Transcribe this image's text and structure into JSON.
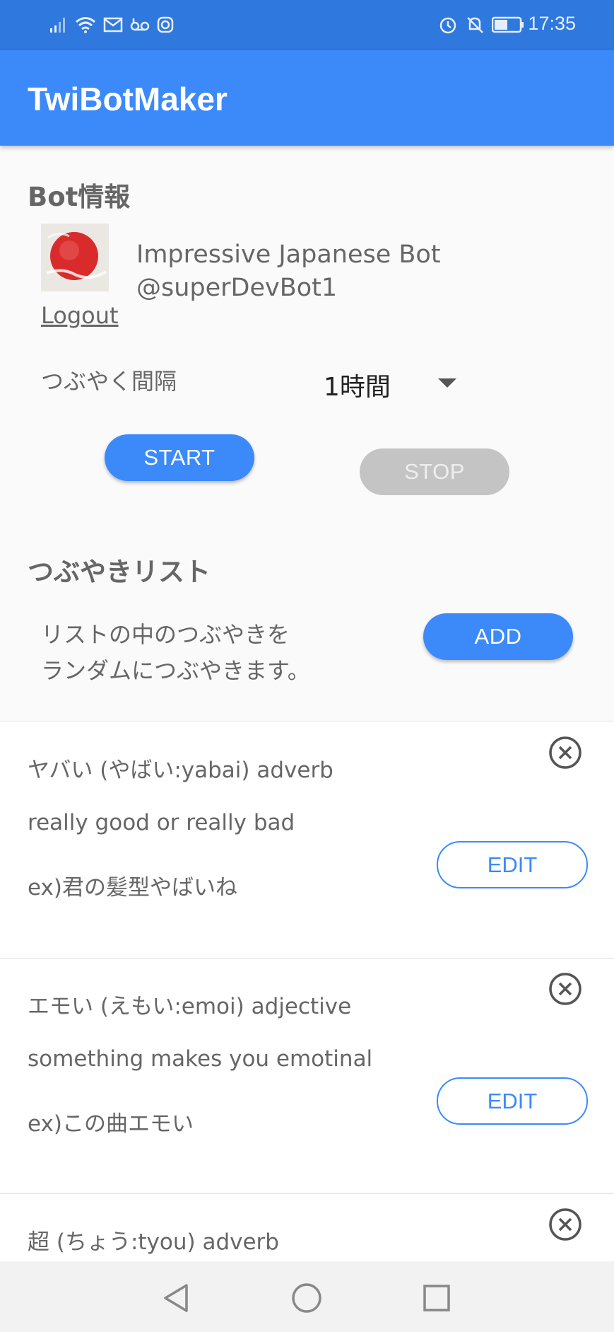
{
  "status_bar": {
    "time": "17:35",
    "left_icons": [
      "signal-icon",
      "wifi-icon",
      "mail-icon",
      "voicemail-icon",
      "instagram-icon"
    ],
    "right_icons": [
      "alarm-icon",
      "notifications-off-icon",
      "battery-icon"
    ]
  },
  "app_bar": {
    "title": "TwiBotMaker"
  },
  "bot_info": {
    "section_title": "Bot情報",
    "name": "Impressive Japanese Bot",
    "handle": "@superDevBot1",
    "logout_label": "Logout",
    "interval_label": "つぶやく間隔",
    "interval_value": "1時間",
    "start_label": "START",
    "stop_label": "STOP"
  },
  "tweet_list": {
    "section_title": "つぶやきリスト",
    "description_line1": "リストの中のつぶやきを",
    "description_line2": "ランダムにつぶやきます。",
    "add_label": "ADD",
    "items": [
      {
        "line1": "ヤバい (やばい:yabai) adverb",
        "line2": "really good or really bad",
        "line3": "ex)君の髪型やばいね",
        "edit_label": "EDIT"
      },
      {
        "line1": "エモい (えもい:emoi) adjective",
        "line2": "something makes you emotinal",
        "line3": "ex)この曲エモい",
        "edit_label": "EDIT"
      },
      {
        "line1": "超 (ちょう:tyou) adverb"
      }
    ]
  },
  "nav_bar": {
    "buttons": [
      "back-icon",
      "home-icon",
      "recents-icon"
    ]
  },
  "colors": {
    "primary": "#3c8afa",
    "status_bar": "#2f78dd",
    "disabled": "#c4c4c4"
  }
}
